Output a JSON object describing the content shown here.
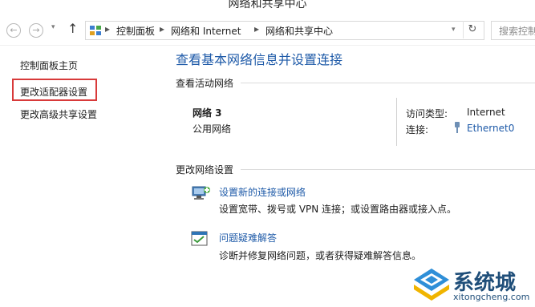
{
  "window": {
    "title": "网络和共享中心"
  },
  "address_bar": {
    "breadcrumbs": [
      "控制面板",
      "网络和 Internet",
      "网络和共享中心"
    ],
    "search_placeholder": "搜索控制"
  },
  "left_nav": {
    "items": [
      "控制面板主页",
      "更改适配器设置",
      "更改高级共享设置"
    ],
    "highlighted_index": 1
  },
  "main": {
    "heading": "查看基本网络信息并设置连接",
    "active_networks_label": "查看活动网络",
    "network": {
      "name": "网络  3",
      "type": "公用网络",
      "access_type_label": "访问类型:",
      "access_type_value": "Internet",
      "connections_label": "连接:",
      "connections_value": "Ethernet0"
    },
    "change_settings_label": "更改网络设置",
    "actions": [
      {
        "title": "设置新的连接或网络",
        "description": "设置宽带、拨号或 VPN 连接；或设置路由器或接入点。",
        "icon": "network-setup-icon"
      },
      {
        "title": "问题疑难解答",
        "description": "诊断并修复网络问题，或者获得疑难解答信息。",
        "icon": "troubleshoot-icon"
      }
    ]
  },
  "watermark": {
    "text": "系统城",
    "url": "xitongcheng.com",
    "color": "#1f4e79"
  }
}
